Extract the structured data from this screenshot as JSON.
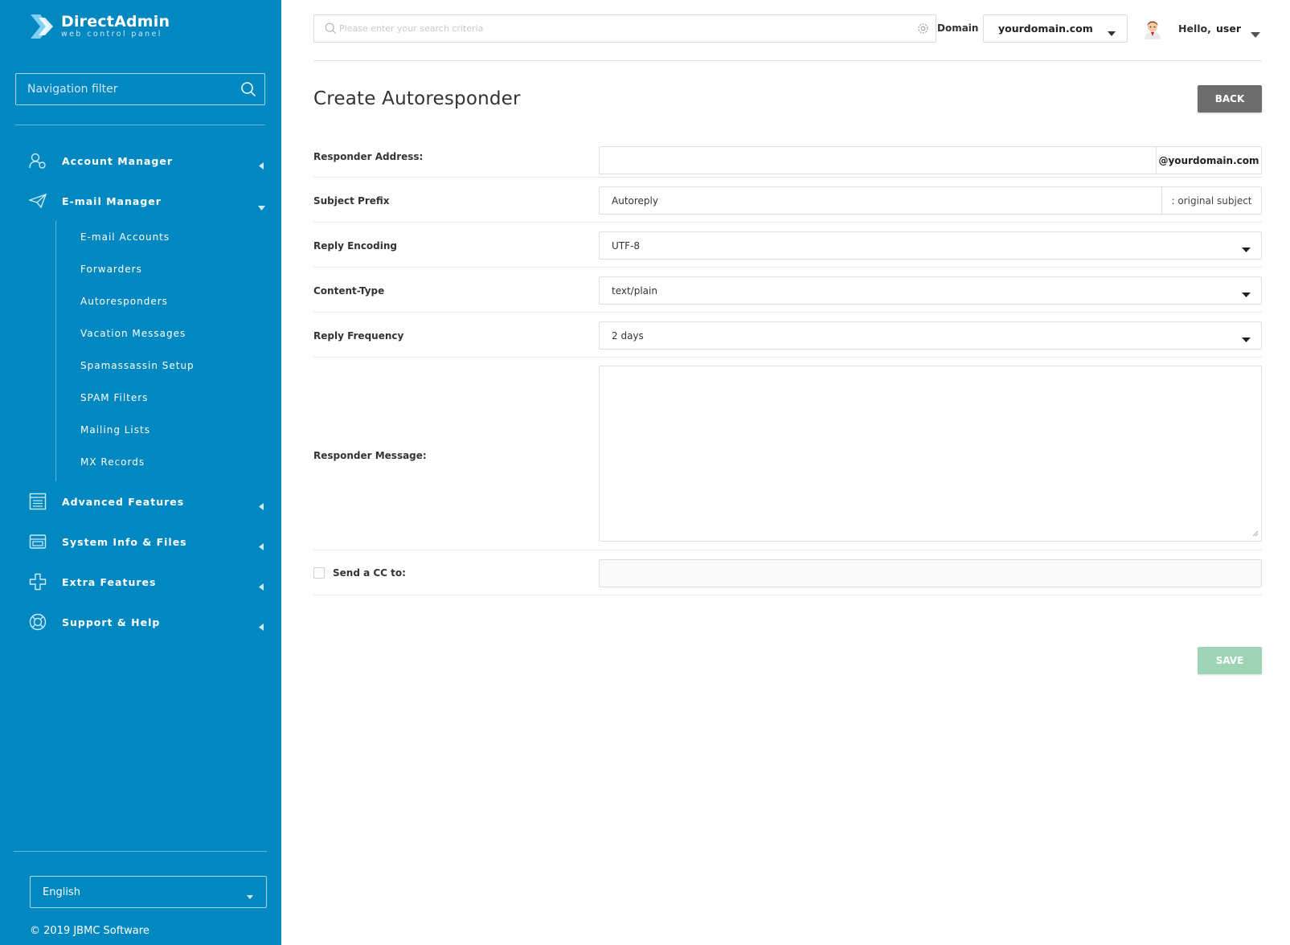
{
  "app": {
    "logo_title": "DirectAdmin",
    "logo_subtitle": "web control panel"
  },
  "sidebar": {
    "filter_placeholder": "Navigation filter",
    "items": [
      {
        "label": "Account Manager",
        "icon": "account-manager-icon",
        "expanded": false
      },
      {
        "label": "E-mail Manager",
        "icon": "paper-plane-icon",
        "expanded": true
      },
      {
        "label": "Advanced Features",
        "icon": "advanced-features-icon",
        "expanded": false
      },
      {
        "label": "System Info & Files",
        "icon": "system-info-icon",
        "expanded": false
      },
      {
        "label": "Extra Features",
        "icon": "plus-icon",
        "expanded": false
      },
      {
        "label": "Support & Help",
        "icon": "lifebuoy-icon",
        "expanded": false
      }
    ],
    "email_subitems": [
      "E-mail Accounts",
      "Forwarders",
      "Autoresponders",
      "Vacation Messages",
      "Spamassassin Setup",
      "SPAM Filters",
      "Mailing Lists",
      "MX Records"
    ],
    "language": "English",
    "copyright": "© 2019 JBMC Software"
  },
  "topbar": {
    "search_placeholder": "Please enter your search criteria",
    "domain_label": "Domain",
    "domain_value": "yourdomain.com",
    "hello": "Hello,",
    "username": "user"
  },
  "page": {
    "title": "Create Autoresponder",
    "back_label": "BACK",
    "save_label": "SAVE"
  },
  "form": {
    "responder_address": {
      "label": "Responder Address:",
      "value": "",
      "suffix": "@yourdomain.com"
    },
    "subject_prefix": {
      "label": "Subject Prefix",
      "value": "Autoreply",
      "suffix": ": original subject"
    },
    "reply_encoding": {
      "label": "Reply Encoding",
      "value": "UTF-8"
    },
    "content_type": {
      "label": "Content-Type",
      "value": "text/plain"
    },
    "reply_frequency": {
      "label": "Reply Frequency",
      "value": "2 days"
    },
    "responder_message": {
      "label": "Responder Message:",
      "value": ""
    },
    "send_cc": {
      "label": "Send a CC to:",
      "checked": false,
      "value": ""
    }
  },
  "colors": {
    "sidebar_bg": "#0288c1",
    "back_button": "#6d6d6d",
    "save_button": "#9fd3b5"
  }
}
